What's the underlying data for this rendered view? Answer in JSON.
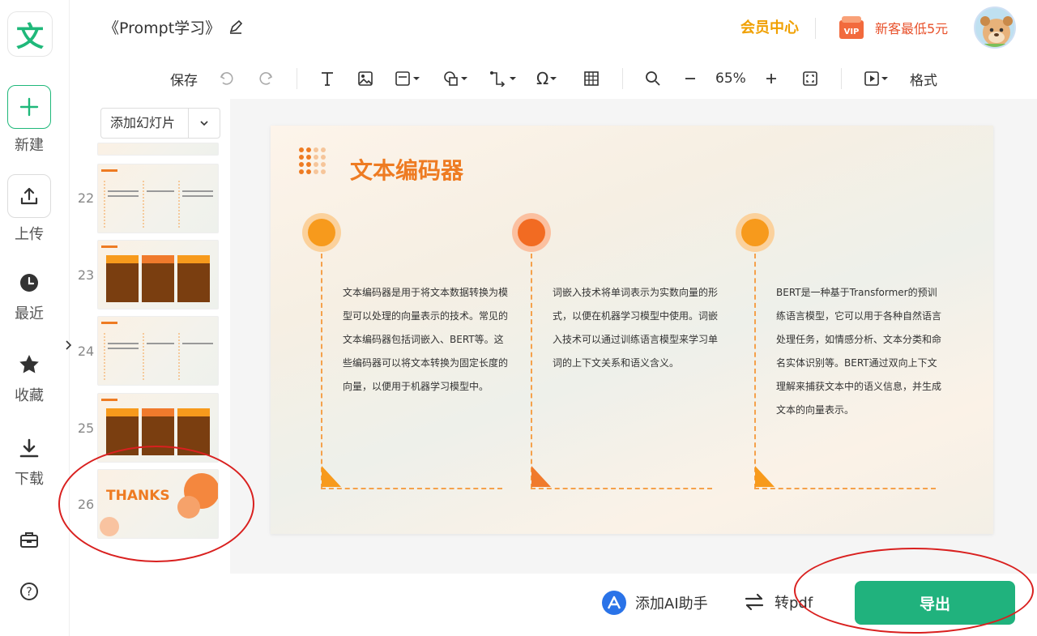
{
  "app": {
    "logo_char": "文",
    "brand_color": "#1fb87a"
  },
  "rail": {
    "items": [
      {
        "label": "新建",
        "icon": "plus-icon"
      },
      {
        "label": "上传",
        "icon": "upload-icon"
      },
      {
        "label": "最近",
        "icon": "clock-icon"
      },
      {
        "label": "收藏",
        "icon": "star-icon"
      },
      {
        "label": "下载",
        "icon": "download-icon"
      }
    ],
    "extra_icons": [
      "toolbox-icon",
      "help-icon"
    ]
  },
  "header": {
    "doc_title": "《Prompt学习》",
    "vip_center": "会员中心",
    "new_offer": "新客最低5元",
    "vip_badge": "VIP"
  },
  "toolbar": {
    "save": "保存",
    "zoom": "65%",
    "format": "格式",
    "icons": [
      "undo-icon",
      "redo-icon",
      "text-icon",
      "image-icon",
      "save-as-icon",
      "shape-icon",
      "connector-icon",
      "symbol-icon",
      "table-icon",
      "search-icon",
      "zoom-out-icon",
      "zoom-in-icon",
      "fit-screen-icon",
      "play-icon"
    ]
  },
  "thumbnails": {
    "add_slide": "添加幻灯片",
    "items": [
      {
        "num": "22"
      },
      {
        "num": "23"
      },
      {
        "num": "24"
      },
      {
        "num": "25"
      },
      {
        "num": "26",
        "text": "THANKS"
      }
    ]
  },
  "slide": {
    "title": "文本编码器",
    "columns": [
      {
        "text": "文本编码器是用于将文本数据转换为模型可以处理的向量表示的技术。常见的文本编码器包括词嵌入、BERT等。这些编码器可以将文本转换为固定长度的向量，以便用于机器学习模型中。"
      },
      {
        "text": "词嵌入技术将单词表示为实数向量的形式，以便在机器学习模型中使用。词嵌入技术可以通过训练语言模型来学习单词的上下文关系和语义含义。"
      },
      {
        "text": "BERT是一种基于Transformer的预训练语言模型，它可以用于各种自然语言处理任务，如情感分析、文本分类和命名实体识别等。BERT通过双向上下文理解来捕获文本中的语义信息，并生成文本的向量表示。"
      }
    ],
    "accent": "#ee7b22"
  },
  "bottombar": {
    "ai_assistant": "添加AI助手",
    "to_pdf": "转pdf",
    "export": "导出",
    "export_color": "#20b27d"
  }
}
